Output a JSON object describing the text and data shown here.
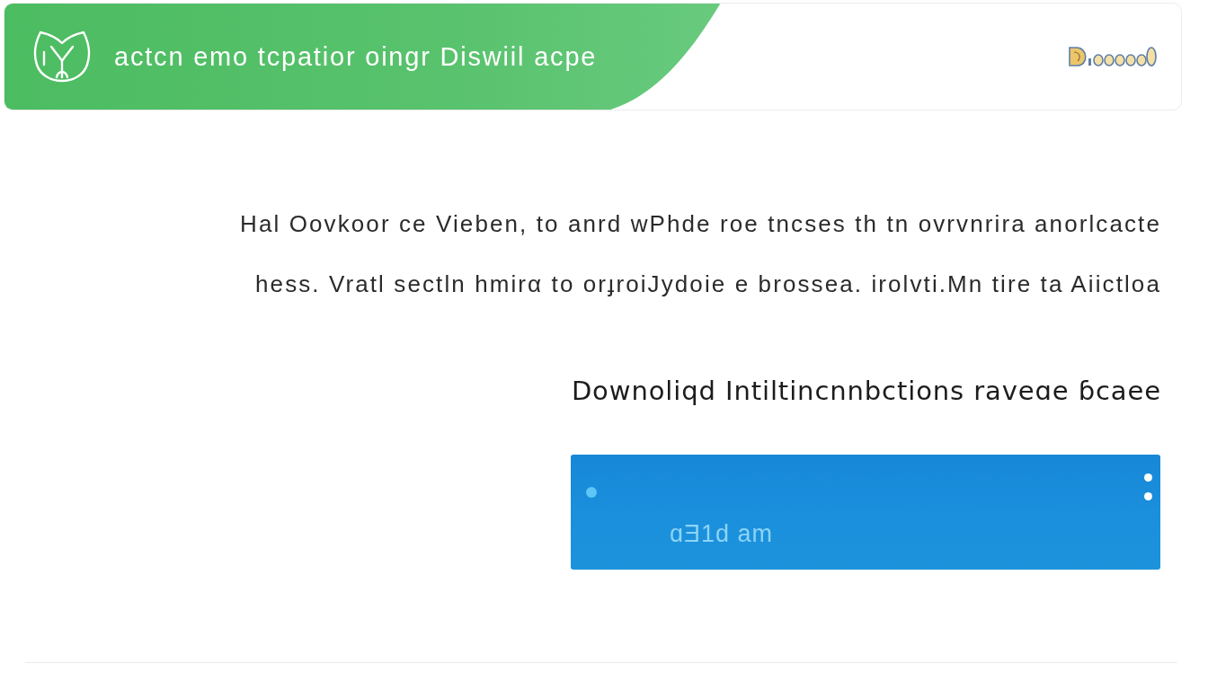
{
  "header": {
    "title": "actcn emo tcpatior oingr Diswiil acpe"
  },
  "intro": {
    "text": "Hal Oovkoor ce Vieben, to anrd wPhde roe tncses th tn  ovrvnrira anorlcacte\nhess.  Vratl  sectln hmirα to orɟroiJydoie e brossea. irolvti.Mn  tire  ta Aiictloa"
  },
  "download": {
    "heading": "Downoliqd Intiltincnnbctions raveɑe ɓcaee",
    "button": {
      "label": "ɑƎ1d am"
    }
  }
}
